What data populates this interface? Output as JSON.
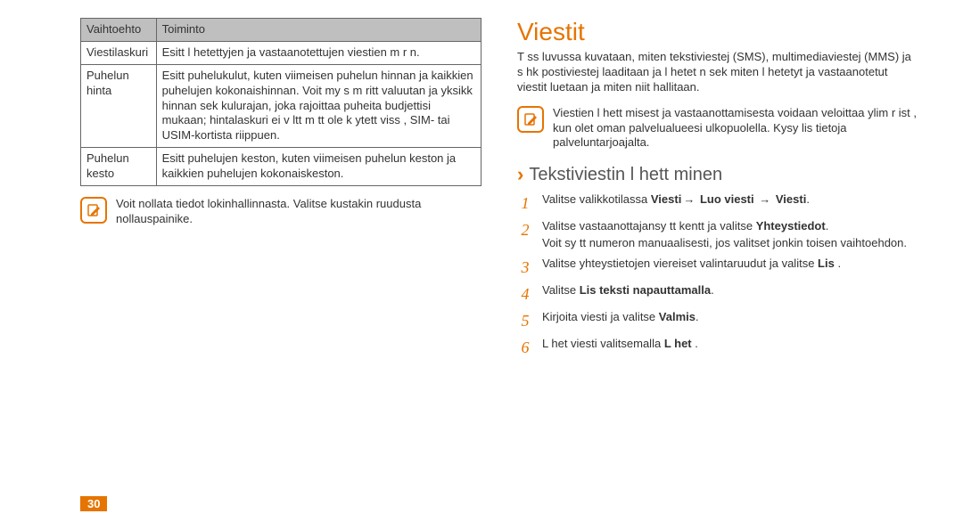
{
  "left": {
    "table": {
      "headers": {
        "col1": "Vaihtoehto",
        "col2": "Toiminto"
      },
      "rows": [
        {
          "opt": "Viestilaskuri",
          "desc": "Esitt   l hetettyjen ja vastaanotettujen viestien m  r n."
        },
        {
          "opt": "Puhelun hinta",
          "desc": "Esitt   puhelukulut, kuten viimeisen puhelun hinnan ja kaikkien puhelujen kokonaishinnan. Voit my s m  ritt   valuutan ja yksikk hinnan sek   kulurajan, joka rajoittaa puheita budjettisi mukaan; hintalaskuri ei v ltt m tt   ole k ytett viss , SIM- tai USIM-kortista riippuen."
        },
        {
          "opt": "Puhelun kesto",
          "desc": "Esitt   puhelujen keston, kuten viimeisen puhelun keston ja kaikkien puhelujen kokonaiskeston."
        }
      ]
    },
    "note": "Voit nollata tiedot lokinhallinnasta. Valitse kustakin ruudusta nollauspainike."
  },
  "right": {
    "title": "Viestit",
    "intro": "T ss  luvussa kuvataan, miten tekstiviestej  (SMS), multimediaviestej  (MMS) ja s hk postiviestej  laaditaan ja l hetet  n sek  miten l hetetyt ja vastaanotetut viestit luetaan ja miten niit  hallitaan.",
    "infobox": "Viestien l hett misest  ja vastaanottamisesta voidaan veloittaa ylim  r ist , kun olet oman palvelualueesi ulkopuolella. Kysy lis tietoja palveluntarjoajalta.",
    "subhead": "Tekstiviestin l hett minen",
    "steps": {
      "s1_a": "Valitse valikkotilassa ",
      "s1_b": "Viesti",
      "s1_c": " Luo viesti",
      "s1_d": "Viesti",
      "s1_end": ".",
      "s2_a": "Valitse vastaanottajansy tt kentt  ja valitse",
      "s2_b": "Yhteystiedot",
      "s2_end": ".",
      "s2_extra": "Voit sy tt   numeron manuaalisesti, jos valitset jonkin toisen vaihtoehdon.",
      "s3_a": "Valitse yhteystietojen viereiset valintaruudut ja valitse",
      "s3_b": "Lis  ",
      "s3_end": ".",
      "s4_a": "Valitse",
      "s4_b": "Lis    teksti  napauttamalla",
      "s4_end": ".",
      "s5_a": "Kirjoita viesti ja valitse",
      "s5_b": "Valmis",
      "s5_end": ".",
      "s6_a": "L het  viesti valitsemalla",
      "s6_b": "L het ",
      "s6_end": "."
    }
  },
  "footer": {
    "page": "30",
    "section": " "
  },
  "icons": {
    "note": "note-icon",
    "chevron": "›"
  }
}
